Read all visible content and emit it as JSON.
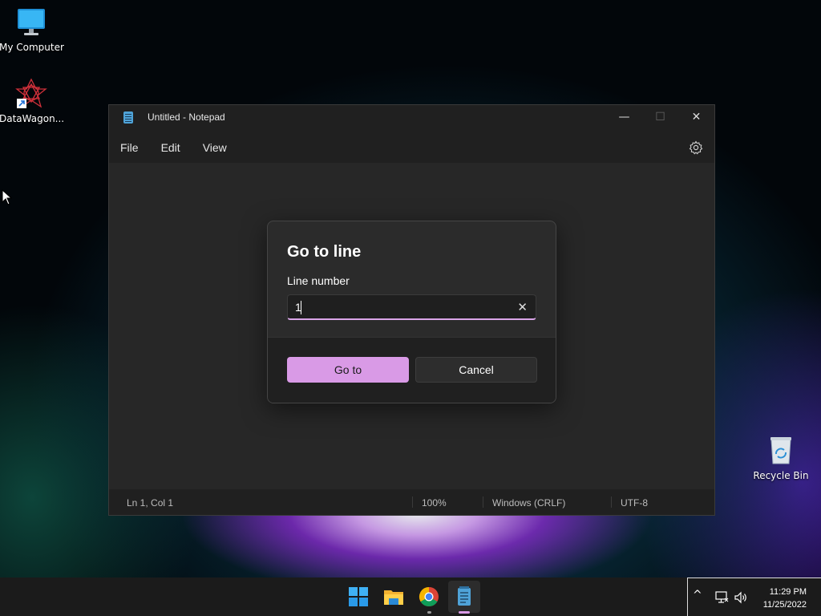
{
  "desktop": {
    "icons": [
      {
        "label": "My Computer",
        "icon": "monitor-icon"
      },
      {
        "label": "DataWagon...",
        "icon": "datawagon-app-icon"
      },
      {
        "label": "Recycle Bin",
        "icon": "recycle-bin-icon"
      }
    ]
  },
  "window": {
    "title": "Untitled - Notepad",
    "controls": {
      "minimize": "—",
      "maximize": "☐",
      "close": "✕"
    },
    "menu": [
      "File",
      "Edit",
      "View"
    ],
    "settings_icon": "gear-icon",
    "status": {
      "position": "Ln 1, Col 1",
      "zoom": "100%",
      "line_ending": "Windows (CRLF)",
      "encoding": "UTF-8"
    }
  },
  "dialog": {
    "title": "Go to line",
    "field_label": "Line number",
    "field_value": "1",
    "clear_glyph": "✕",
    "primary_button": "Go to",
    "secondary_button": "Cancel",
    "accent_color": "#d99ae6"
  },
  "taskbar": {
    "apps": [
      "start-icon",
      "file-explorer-icon",
      "chrome-icon",
      "notepad-icon"
    ],
    "tray": {
      "chevron": "^",
      "time": "11:29 PM",
      "date": "11/25/2022"
    }
  }
}
